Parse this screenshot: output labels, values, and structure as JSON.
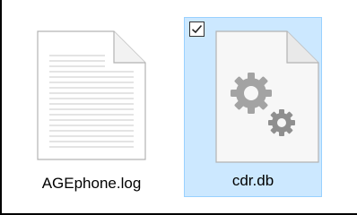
{
  "files": [
    {
      "name": "AGEphone.log",
      "icon": "text-document-icon",
      "selected": false
    },
    {
      "name": "cdr.db",
      "icon": "settings-file-icon",
      "selected": true,
      "checked": true
    }
  ],
  "colors": {
    "selection_fill": "#cce8ff",
    "selection_border": "#99d1ff",
    "gear": "#9a9a9a"
  }
}
